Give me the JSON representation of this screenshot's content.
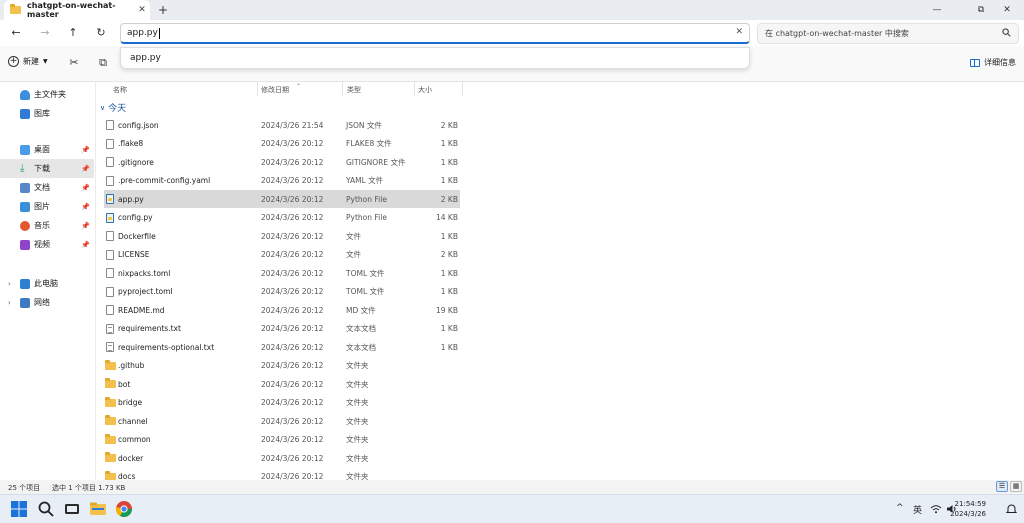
{
  "window": {
    "tab_title": "chatgpt-on-wechat-master",
    "tab_close": "✕",
    "new_tab": "+",
    "minimize": "—",
    "maximize": "⧉",
    "close": "✕"
  },
  "nav": {
    "back": "←",
    "forward": "→",
    "up": "↑",
    "refresh": "↻"
  },
  "address": {
    "value": "app.py",
    "clear": "✕",
    "suggestion": "app.py"
  },
  "search": {
    "placeholder": "在 chatgpt-on-wechat-master 中搜索"
  },
  "toolbar": {
    "new_label": "新建",
    "details_label": "详细信息"
  },
  "sidebar": {
    "items": [
      {
        "label": "主文件夹"
      },
      {
        "label": "图库"
      },
      {
        "label": "桌面"
      },
      {
        "label": "下载"
      },
      {
        "label": "文档"
      },
      {
        "label": "图片"
      },
      {
        "label": "音乐"
      },
      {
        "label": "视频"
      },
      {
        "label": "此电脑"
      },
      {
        "label": "网络"
      }
    ]
  },
  "columns": {
    "name": "名称",
    "date": "修改日期",
    "type": "类型",
    "size": "大小"
  },
  "group": {
    "label": "今天"
  },
  "files": [
    {
      "name": "config.json",
      "date": "2024/3/26 21:54",
      "type": "JSON 文件",
      "size": "2 KB",
      "icon": "file"
    },
    {
      "name": ".flake8",
      "date": "2024/3/26 20:12",
      "type": "FLAKE8 文件",
      "size": "1 KB",
      "icon": "file"
    },
    {
      "name": ".gitignore",
      "date": "2024/3/26 20:12",
      "type": "GITIGNORE 文件",
      "size": "1 KB",
      "icon": "file"
    },
    {
      "name": ".pre-commit-config.yaml",
      "date": "2024/3/26 20:12",
      "type": "YAML 文件",
      "size": "1 KB",
      "icon": "file"
    },
    {
      "name": "app.py",
      "date": "2024/3/26 20:12",
      "type": "Python File",
      "size": "2 KB",
      "icon": "py",
      "selected": true
    },
    {
      "name": "config.py",
      "date": "2024/3/26 20:12",
      "type": "Python File",
      "size": "14 KB",
      "icon": "py"
    },
    {
      "name": "Dockerfile",
      "date": "2024/3/26 20:12",
      "type": "文件",
      "size": "1 KB",
      "icon": "file"
    },
    {
      "name": "LICENSE",
      "date": "2024/3/26 20:12",
      "type": "文件",
      "size": "2 KB",
      "icon": "file"
    },
    {
      "name": "nixpacks.toml",
      "date": "2024/3/26 20:12",
      "type": "TOML 文件",
      "size": "1 KB",
      "icon": "file"
    },
    {
      "name": "pyproject.toml",
      "date": "2024/3/26 20:12",
      "type": "TOML 文件",
      "size": "1 KB",
      "icon": "file"
    },
    {
      "name": "README.md",
      "date": "2024/3/26 20:12",
      "type": "MD 文件",
      "size": "19 KB",
      "icon": "file"
    },
    {
      "name": "requirements.txt",
      "date": "2024/3/26 20:12",
      "type": "文本文档",
      "size": "1 KB",
      "icon": "txt"
    },
    {
      "name": "requirements-optional.txt",
      "date": "2024/3/26 20:12",
      "type": "文本文档",
      "size": "1 KB",
      "icon": "txt"
    },
    {
      "name": ".github",
      "date": "2024/3/26 20:12",
      "type": "文件夹",
      "size": "",
      "icon": "folder"
    },
    {
      "name": "bot",
      "date": "2024/3/26 20:12",
      "type": "文件夹",
      "size": "",
      "icon": "folder"
    },
    {
      "name": "bridge",
      "date": "2024/3/26 20:12",
      "type": "文件夹",
      "size": "",
      "icon": "folder"
    },
    {
      "name": "channel",
      "date": "2024/3/26 20:12",
      "type": "文件夹",
      "size": "",
      "icon": "folder"
    },
    {
      "name": "common",
      "date": "2024/3/26 20:12",
      "type": "文件夹",
      "size": "",
      "icon": "folder"
    },
    {
      "name": "docker",
      "date": "2024/3/26 20:12",
      "type": "文件夹",
      "size": "",
      "icon": "folder"
    },
    {
      "name": "docs",
      "date": "2024/3/26 20:12",
      "type": "文件夹",
      "size": "",
      "icon": "folder"
    }
  ],
  "status": {
    "count": "25 个项目",
    "selected": "选中 1 个项目  1.73 KB"
  },
  "taskbar": {
    "chevron": "^",
    "ime": "英",
    "time": "21:54:59",
    "date": "2024/3/26"
  },
  "colors": {
    "accent": "#1a6dd0",
    "folder": "#f4c04d",
    "selection": "#d9d9d9"
  }
}
